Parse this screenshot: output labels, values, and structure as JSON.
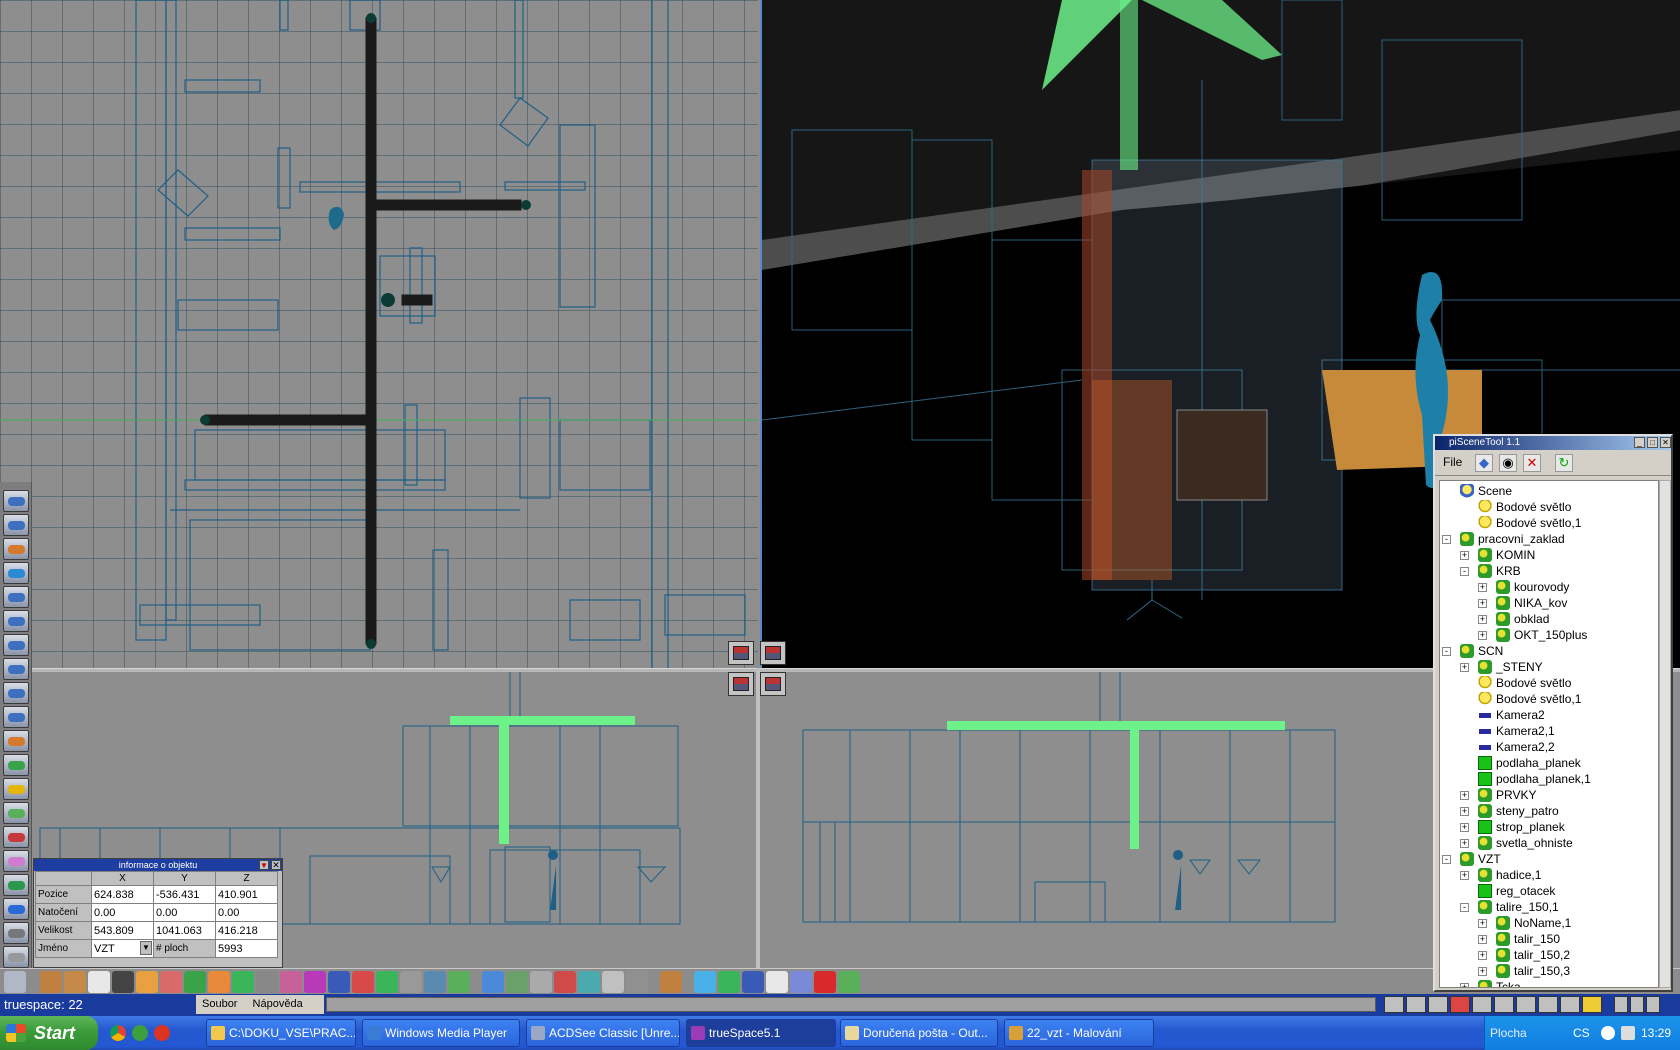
{
  "scene_tool": {
    "title": "piSceneTool 1.1",
    "menu_file": "File",
    "tree": [
      {
        "label": "Scene",
        "depth": 0,
        "icon": "scene-icon",
        "expander": ""
      },
      {
        "label": "Bodové světlo",
        "depth": 1,
        "icon": "bulb-icon",
        "expander": ""
      },
      {
        "label": "Bodové světlo,1",
        "depth": 1,
        "icon": "bulb-icon",
        "expander": ""
      },
      {
        "label": "pracovni_zaklad",
        "depth": 0,
        "icon": "group-icon",
        "expander": "-"
      },
      {
        "label": "KOMIN",
        "depth": 1,
        "icon": "group-icon",
        "expander": "+"
      },
      {
        "label": "KRB",
        "depth": 1,
        "icon": "group-icon",
        "expander": "-"
      },
      {
        "label": "kourovody",
        "depth": 2,
        "icon": "group-icon",
        "expander": "+"
      },
      {
        "label": "NIKA_kov",
        "depth": 2,
        "icon": "group-icon",
        "expander": "+"
      },
      {
        "label": "obklad",
        "depth": 2,
        "icon": "group-icon",
        "expander": "+"
      },
      {
        "label": "OKT_150plus",
        "depth": 2,
        "icon": "group-icon",
        "expander": "+"
      },
      {
        "label": "SCN",
        "depth": 0,
        "icon": "group-icon",
        "expander": "-"
      },
      {
        "label": "_STENY",
        "depth": 1,
        "icon": "group-icon",
        "expander": "+"
      },
      {
        "label": "Bodové světlo",
        "depth": 1,
        "icon": "bulb-icon",
        "expander": ""
      },
      {
        "label": "Bodové světlo,1",
        "depth": 1,
        "icon": "bulb-icon",
        "expander": ""
      },
      {
        "label": "Kamera2",
        "depth": 1,
        "icon": "camera-icon",
        "expander": ""
      },
      {
        "label": "Kamera2,1",
        "depth": 1,
        "icon": "camera-icon",
        "expander": ""
      },
      {
        "label": "Kamera2,2",
        "depth": 1,
        "icon": "camera-icon",
        "expander": ""
      },
      {
        "label": "podlaha_planek",
        "depth": 1,
        "icon": "mesh-icon",
        "expander": ""
      },
      {
        "label": "podlaha_planek,1",
        "depth": 1,
        "icon": "mesh-icon",
        "expander": ""
      },
      {
        "label": "PRVKY",
        "depth": 1,
        "icon": "group-icon",
        "expander": "+"
      },
      {
        "label": "steny_patro",
        "depth": 1,
        "icon": "group-icon",
        "expander": "+"
      },
      {
        "label": "strop_planek",
        "depth": 1,
        "icon": "mesh-icon",
        "expander": "+"
      },
      {
        "label": "svetla_ohniste",
        "depth": 1,
        "icon": "group-icon",
        "expander": "+"
      },
      {
        "label": "VZT",
        "depth": 0,
        "icon": "group-icon",
        "expander": "-"
      },
      {
        "label": "hadice,1",
        "depth": 1,
        "icon": "group-icon",
        "expander": "+"
      },
      {
        "label": "reg_otacek",
        "depth": 1,
        "icon": "mesh-icon",
        "expander": ""
      },
      {
        "label": "talire_150,1",
        "depth": 1,
        "icon": "group-icon",
        "expander": "-"
      },
      {
        "label": "NoName,1",
        "depth": 2,
        "icon": "group-icon",
        "expander": "+"
      },
      {
        "label": "talir_150",
        "depth": 2,
        "icon": "group-icon",
        "expander": "+"
      },
      {
        "label": "talir_150,2",
        "depth": 2,
        "icon": "group-icon",
        "expander": "+"
      },
      {
        "label": "talir_150,3",
        "depth": 2,
        "icon": "group-icon",
        "expander": "+"
      },
      {
        "label": "Tcka",
        "depth": 1,
        "icon": "group-icon",
        "expander": "+"
      }
    ]
  },
  "info_panel": {
    "title": "informace o objektu",
    "col_x": "X",
    "col_y": "Y",
    "col_z": "Z",
    "pozice_label": "Pozice",
    "pozice": [
      "624.838",
      "-536.431",
      "410.901"
    ],
    "natoceni_label": "Natočení",
    "natoceni": [
      "0.00",
      "0.00",
      "0.00"
    ],
    "velikost_label": "Velikost",
    "velikost": [
      "543.809",
      "1041.063",
      "416.218"
    ],
    "jmeno_label": "Jméno",
    "jmeno_value": "VZT",
    "ploch_label": "# ploch",
    "ploch_value": "5993"
  },
  "status_bar": {
    "title": "truespace: 22",
    "menu_soubor": "Soubor",
    "menu_napoveda": "Nápověda"
  },
  "taskbar": {
    "start": "Start",
    "items": [
      {
        "label": "C:\\DOKU_VSE\\PRAC...",
        "icon": "folder-icon",
        "color": "#f2c94c"
      },
      {
        "label": "Windows Media Player",
        "icon": "media-player-icon",
        "color": "#3a7bd5"
      },
      {
        "label": "ACDSee Classic [Unre...",
        "icon": "acdsee-icon",
        "color": "#9aa8c6"
      },
      {
        "label": "trueSpace5.1",
        "icon": "truespace-icon",
        "color": "#9b3bb5"
      },
      {
        "label": "Doručená pošta - Out...",
        "icon": "outlook-icon",
        "color": "#e8d8a0"
      },
      {
        "label": "22_vzt - Malování",
        "icon": "paint-icon",
        "color": "#d9a03a"
      }
    ],
    "tray_label": "Plocha",
    "lang": "CS",
    "clock": "13:29"
  },
  "colors": {
    "duct_green": "#6df28a",
    "wire_blue": "#1f5f86",
    "title_blue": "#1a3b9e"
  }
}
